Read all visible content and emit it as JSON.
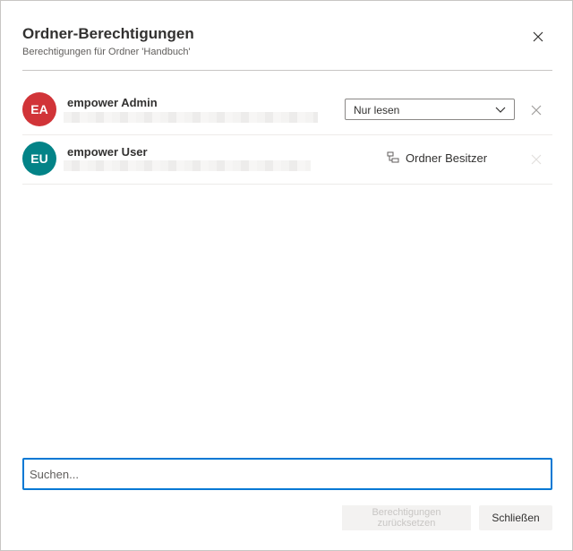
{
  "dialog": {
    "title": "Ordner-Berechtigungen",
    "subtitle": "Berechtigungen für Ordner 'Handbuch'",
    "close_icon": "close-icon"
  },
  "users": [
    {
      "initials": "EA",
      "name": "empower Admin",
      "avatar_color": "#d13438",
      "permission": "Nur lesen",
      "remove_icon": "close-icon"
    },
    {
      "initials": "EU",
      "name": "empower User",
      "avatar_color": "#038387",
      "role": "Ordner Besitzer",
      "role_icon": "owner-icon",
      "remove_icon": "close-icon"
    }
  ],
  "search": {
    "placeholder": "Suchen..."
  },
  "footer": {
    "reset_label": "Berechtigungen zurücksetzen",
    "close_label": "Schließen"
  },
  "colors": {
    "accent": "#0078d4",
    "divider": "#c8c6c4"
  }
}
